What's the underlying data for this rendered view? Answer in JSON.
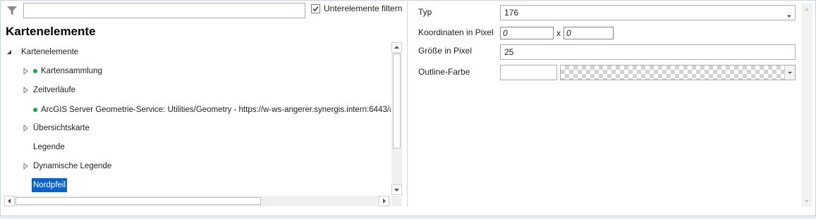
{
  "filter": {
    "input_value": "",
    "checkbox_label": "Unterelemente filtern",
    "checkbox_checked": true
  },
  "panel": {
    "title": "Kartenelemente"
  },
  "tree": {
    "items": [
      {
        "label": "Kartenelemente",
        "expander": "expanded",
        "dot": false,
        "selected": false
      },
      {
        "label": "Kartensammlung",
        "expander": "collapsed",
        "dot": true,
        "selected": false
      },
      {
        "label": "Zeitverläufe",
        "expander": "collapsed",
        "dot": false,
        "selected": false
      },
      {
        "label": "ArcGIS Server Geometrie-Service: Utilities/Geometry - https://w-ws-angerer.synergis.intern:6443/a",
        "expander": "none",
        "dot": true,
        "selected": false
      },
      {
        "label": "Übersichtskarte",
        "expander": "collapsed",
        "dot": false,
        "selected": false
      },
      {
        "label": "Legende",
        "expander": "none",
        "dot": false,
        "selected": false
      },
      {
        "label": "Dynamische Legende",
        "expander": "collapsed",
        "dot": false,
        "selected": false
      },
      {
        "label": "Nordpfeil",
        "expander": "none",
        "dot": false,
        "selected": true
      }
    ]
  },
  "properties": {
    "typ_label": "Typ",
    "typ_value": "176",
    "coords_label": "Koordinaten in Pixel",
    "coord_x": "0",
    "coord_sep": "x",
    "coord_y": "0",
    "size_label": "Größe in Pixel",
    "size_value": "25",
    "outline_label": "Outline-Farbe",
    "outline_value": ""
  },
  "colors": {
    "accent": "#0a64c8",
    "status_dot": "#1aa33a"
  },
  "icons": {
    "filter": "filter-funnel-icon",
    "checkbox": "checkmark-icon",
    "expand": "triangle-expanded-icon",
    "collapse": "triangle-collapsed-icon",
    "status": "green-dot-icon",
    "dropdown": "chevron-down-icon"
  }
}
